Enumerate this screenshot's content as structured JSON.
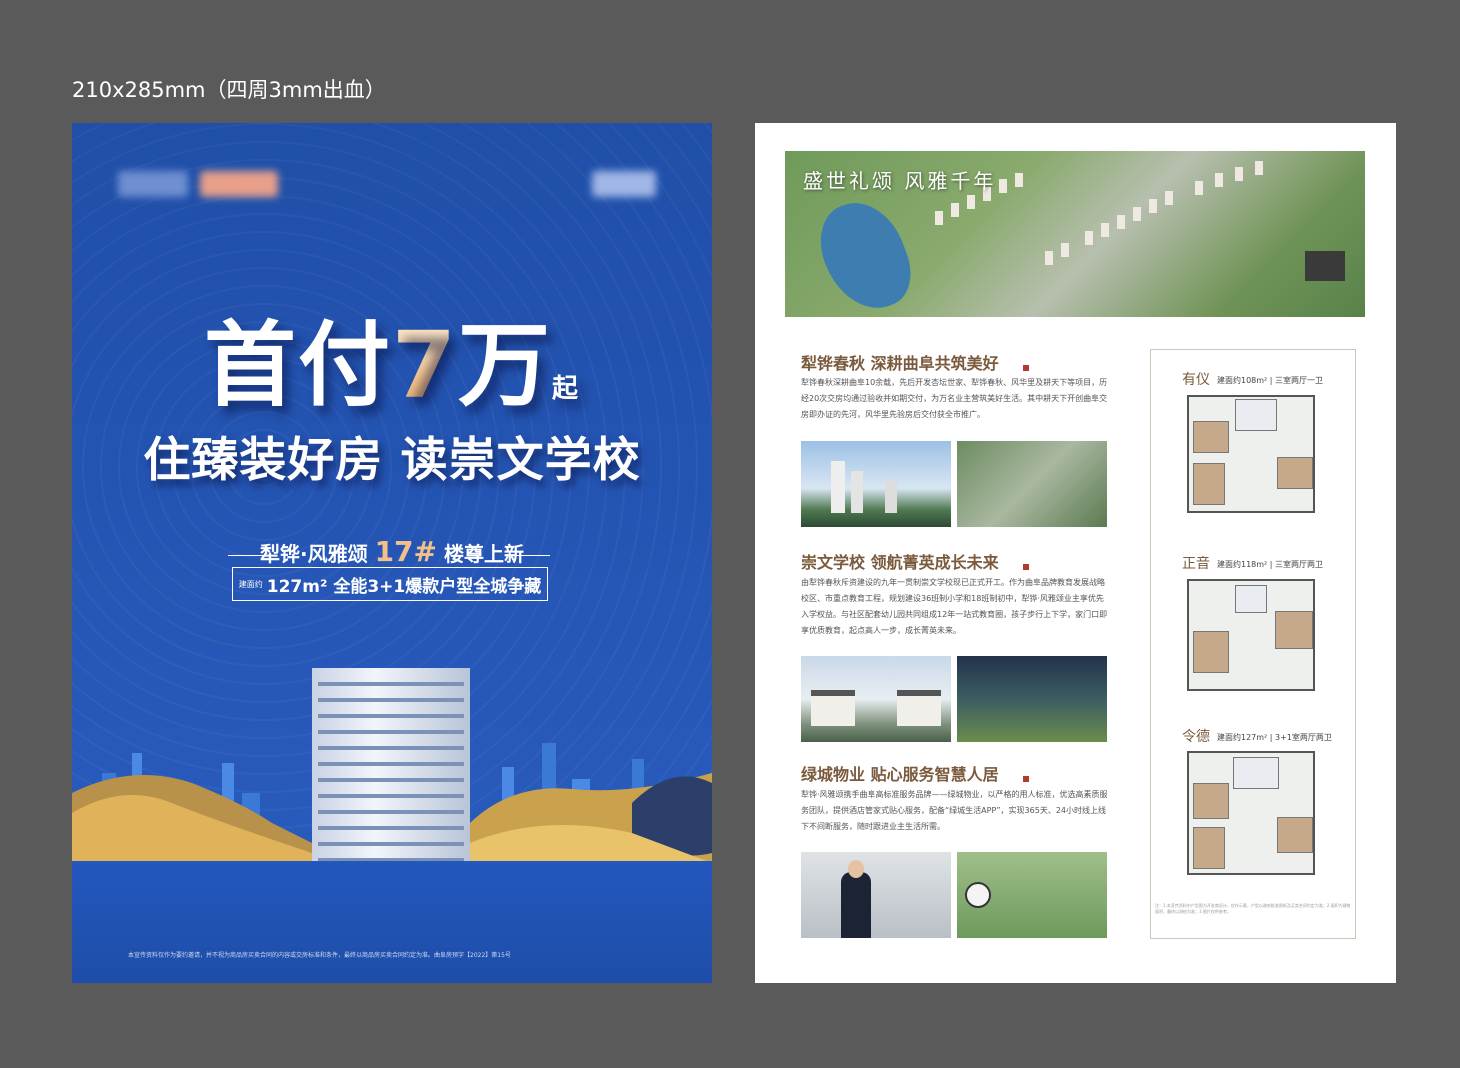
{
  "spec_label": "210x285mm（四周3mm出血）",
  "front": {
    "headline_prefix": "首付",
    "headline_number": "7",
    "headline_unit": "万",
    "headline_suffix": "起",
    "tagline": "住臻装好房 读崇文学校",
    "sub_line_part1": "犁铧·风雅颂",
    "sub_line_highlight": "17#",
    "sub_line_part2": "楼尊上新",
    "sub_box_tag": "建面约",
    "sub_box_text": "127m² 全能3+1爆款户型全城争藏",
    "disclaimer": "本宣传资料仅作为要约邀请，并不视为商品房买卖合同的内容或交房标准和条件，最终以商品房买卖合同约定为准。曲阜房预字【2022】第15号"
  },
  "back": {
    "banner_title": "盛世礼颂 风雅千年",
    "sections": [
      {
        "title": "犁铧春秋 深耕曲阜共筑美好",
        "body": "犁铧春秋深耕曲阜10余载，先后开发杏坛世家、犁铧春秋、风华里及耕天下等项目，历经20次交房均通过验收并如期交付，为万名业主营筑美好生活。其中耕天下开创曲阜交房即办证的先河，风华里先验房后交付获全市推广。"
      },
      {
        "title": "崇文学校 领航菁英成长未来",
        "body": "由犁铧春秋斥资建设的九年一贯制崇文学校现已正式开工。作为曲阜品牌教育发展战略校区、市重点教育工程，规划建设36班制小学和18班制初中，犁铧·风雅颂业主享优先入学权益。与社区配套幼儿园共同组成12年一站式教育圈，孩子步行上下学，家门口即享优质教育，起点高人一步，成长菁英未来。"
      },
      {
        "title": "绿城物业 贴心服务智慧人居",
        "body": "犁铧·风雅颂携手曲阜高标准服务品牌——绿城物业，以严格的用人标准，优选高素质服务团队，提供酒店管家式贴心服务，配备“绿城生活APP”，实现365天、24小时线上线下不间断服务，随时跟进业主生活所需。"
      }
    ],
    "floorplans": [
      {
        "name": "有仪",
        "spec": "建面约108m² | 三室两厅一卫"
      },
      {
        "name": "正音",
        "spec": "建面约118m² | 三室两厅两卫"
      },
      {
        "name": "令德",
        "spec": "建面约127m² | 3+1室两厅两卫"
      }
    ],
    "footnote": "注：1.本宣传资料中户型图为开发商设计，仅作示意，户型以政府批准图纸及买卖合同约定为准；2.面积为建筑面积，最终以测绘为准；3.图片仅供参考。"
  },
  "colors": {
    "front_bg": "#2656b6",
    "accent_gold": "#f2c08a",
    "section_title": "#7a5a3c",
    "seal_red": "#b23a2e"
  }
}
